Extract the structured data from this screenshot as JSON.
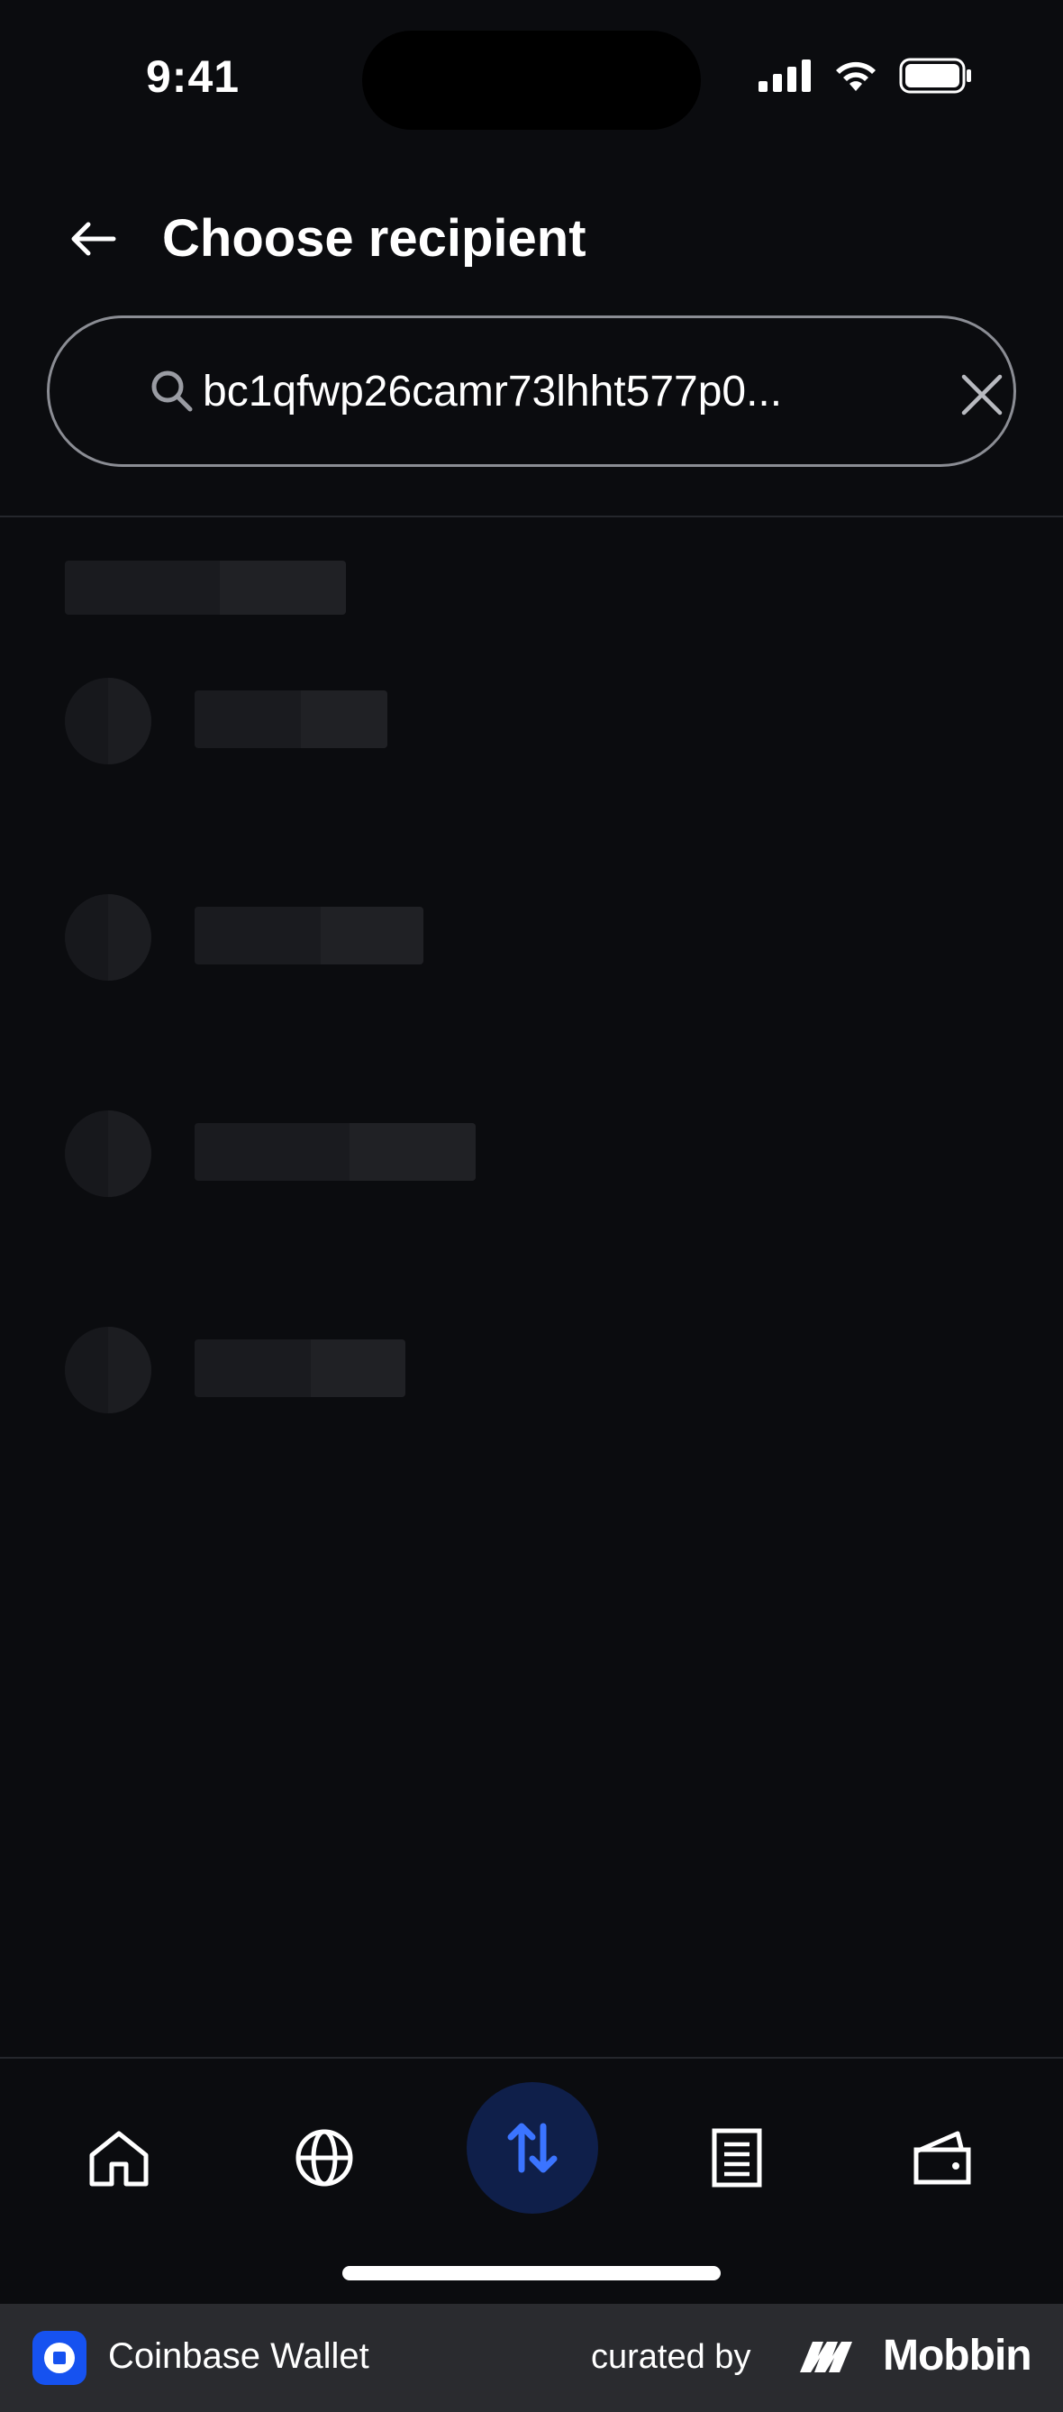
{
  "status_bar": {
    "time": "9:41"
  },
  "header": {
    "title": "Choose recipient"
  },
  "search": {
    "value": "bc1qfwp26camr73lhht577p0..."
  },
  "tabs": [
    {
      "name": "home",
      "icon": "home-icon"
    },
    {
      "name": "browser",
      "icon": "globe-icon"
    },
    {
      "name": "send-receive",
      "icon": "arrows-up-down-icon",
      "active": true
    },
    {
      "name": "activity",
      "icon": "document-icon"
    },
    {
      "name": "wallet",
      "icon": "wallet-icon"
    }
  ],
  "footer": {
    "app_name": "Coinbase Wallet",
    "curated_by": "curated by",
    "brand": "Mobbin"
  },
  "colors": {
    "background": "#0b0c0f",
    "accent": "#1652f0",
    "active_tab_bg": "#0f1f4a",
    "active_tab_icon": "#3b74ff"
  }
}
